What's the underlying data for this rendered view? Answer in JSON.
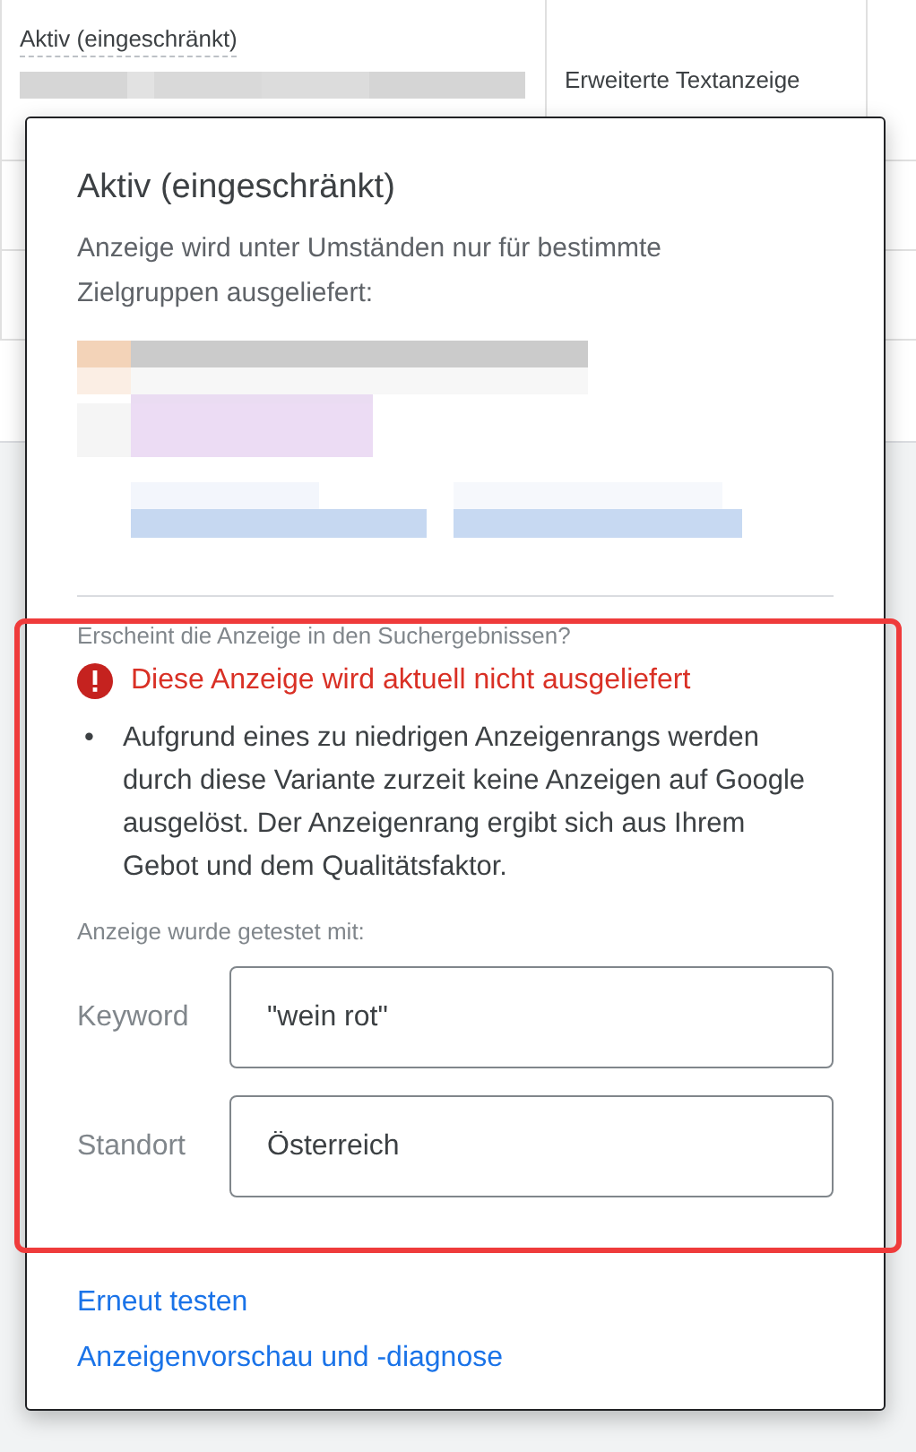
{
  "table": {
    "rows": [
      {
        "status": "Aktiv (eingeschränkt)",
        "ad_type": "Erweiterte Textanzeige"
      }
    ]
  },
  "popup": {
    "title": "Aktiv (eingeschränkt)",
    "description": "Anzeige wird unter Umständen nur für bestimmte Zielgruppen ausgeliefert:",
    "question": "Erscheint die Anzeige in den Suchergebnissen?",
    "error": "Diese Anzeige wird aktuell nicht ausgeliefert",
    "bullet_marker": "•",
    "bullets": [
      "Aufgrund eines zu niedrigen Anzeigenrangs werden durch diese Variante zurzeit keine Anzeigen auf Google ausgelöst. Der Anzeigenrang ergibt sich aus Ihrem Gebot und dem Qualitätsfaktor."
    ],
    "tested_with_label": "Anzeige wurde getestet mit:",
    "fields": [
      {
        "label": "Keyword",
        "value": "\"wein rot\""
      },
      {
        "label": "Standort",
        "value": "Österreich"
      }
    ],
    "links": [
      "Erneut testen",
      "Anzeigenvorschau und -diagnose"
    ]
  }
}
